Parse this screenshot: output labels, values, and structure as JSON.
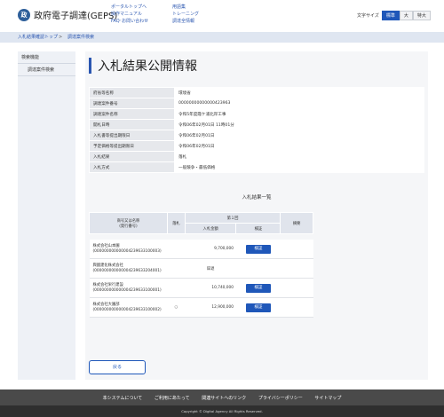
{
  "header": {
    "logo_mark": "政",
    "site_title": "政府電子調達(GEPS)",
    "links_col1": [
      "ポータルトップへ",
      "操作マニュアル",
      "FAQ･お問い合わせ"
    ],
    "links_col2": [
      "用語集",
      "トレーニング",
      "調達全情報"
    ],
    "font_size": {
      "label": "文字サイズ",
      "options": [
        "標準",
        "大",
        "特大"
      ],
      "selected": "標準"
    }
  },
  "breadcrumb": [
    "入札結果確認トップ",
    "調達案件検索"
  ],
  "breadcrumb_separator": ">",
  "sidebar": {
    "heading": "検索機能",
    "items": [
      "調達案件検索"
    ]
  },
  "main": {
    "title": "入札結果公開情報",
    "info_rows": [
      {
        "label": "府省等名称",
        "value": "環境省"
      },
      {
        "label": "調達案件番号",
        "value": "00000000000000423963"
      },
      {
        "label": "調達案件名称",
        "value": "令和5年度霞ケ浦北岸工事"
      },
      {
        "label": "開札日時",
        "value": "令和06年02月01日 11時01分"
      },
      {
        "label": "入札書等提出期限日",
        "value": "令和06年02月01日"
      },
      {
        "label": "予定価格等提出期限日",
        "value": "令和06年02月01日"
      },
      {
        "label": "入札結果",
        "value": "落札"
      },
      {
        "label": "入札方式",
        "value": "一般競争・最低価格"
      }
    ],
    "results_title": "入札結果一覧",
    "results_table": {
      "header_name": "商号又は名称",
      "header_name_sub": "(発行番号)",
      "header_award": "落札",
      "header_round": "第１回",
      "header_amount": "入札金額",
      "header_verify": "検証",
      "header_note": "摘要",
      "rows": [
        {
          "name": "株式会社山本園",
          "code": "(000000000000004239633100003)",
          "award": "",
          "amount": "9,700,000",
          "verify": "検証",
          "note": ""
        },
        {
          "name": "興國建化株式会社",
          "code": "(000000000000004239633204001)",
          "award": "",
          "amount": "辞退",
          "verify": "",
          "note": ""
        },
        {
          "name": "株式会社栄行建設",
          "code": "(000000000000004239633100001)",
          "award": "",
          "amount": "10,740,000",
          "verify": "検証",
          "note": ""
        },
        {
          "name": "株式会社大園部",
          "code": "(000000000000004239633100002)",
          "award": "○",
          "amount": "12,900,000",
          "verify": "検証",
          "note": ""
        }
      ]
    },
    "back_button": "戻る"
  },
  "footer": {
    "links": [
      "本システムについて",
      "ご利用にあたって",
      "関連サイトへのリンク",
      "プライバシーポリシー",
      "サイトマップ"
    ],
    "copyright": "Copyright © Digital Agency All Rights Reserved."
  },
  "colors": {
    "accent": "#1f57b9",
    "crumb_bar": "#dfe6f1",
    "footer": "#4a4a4a"
  }
}
